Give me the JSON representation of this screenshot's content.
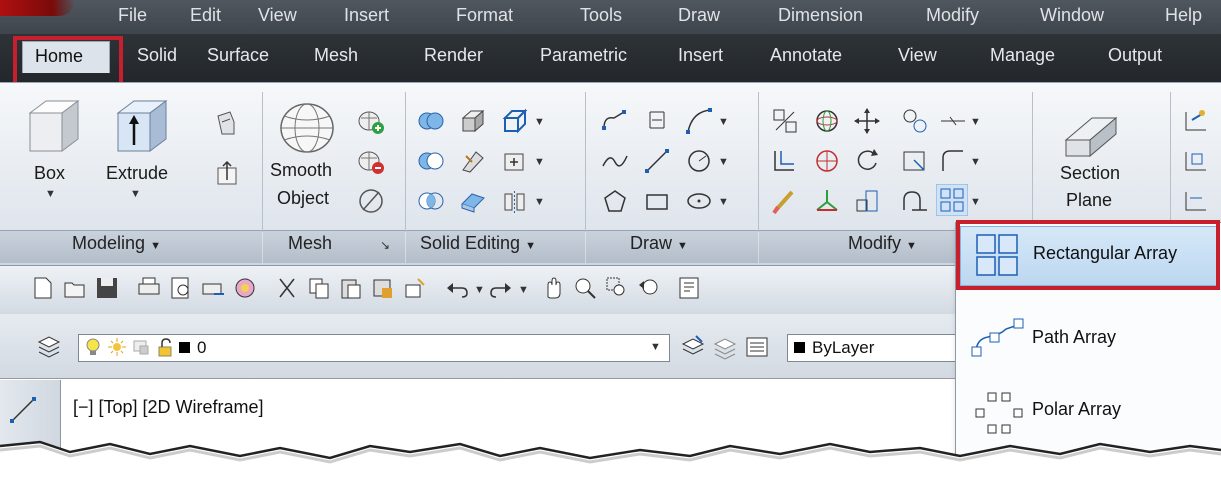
{
  "menubar": {
    "items": [
      "File",
      "Edit",
      "View",
      "Insert",
      "Format",
      "Tools",
      "Draw",
      "Dimension",
      "Modify",
      "Window",
      "Help"
    ]
  },
  "ribbon_tabs": {
    "active": "Home",
    "items": [
      "Solid",
      "Surface",
      "Mesh",
      "Render",
      "Parametric",
      "Insert",
      "Annotate",
      "View",
      "Manage",
      "Output"
    ]
  },
  "modeling": {
    "box_label": "Box",
    "extrude_label": "Extrude",
    "panel_label": "Modeling"
  },
  "mesh": {
    "smooth_label_1": "Smooth",
    "smooth_label_2": "Object",
    "panel_label": "Mesh"
  },
  "solid_editing": {
    "panel_label": "Solid Editing"
  },
  "draw": {
    "panel_label": "Draw"
  },
  "modify": {
    "panel_label": "Modify"
  },
  "section": {
    "label_1": "Section",
    "label_2": "Plane"
  },
  "layer_toolbar": {
    "current_layer": "0",
    "color_combo": "ByLayer"
  },
  "viewport": {
    "label": "[−] [Top] [2D Wireframe]"
  },
  "array_menu": {
    "rectangular": "Rectangular Array",
    "path": "Path Array",
    "polar": "Polar Array"
  },
  "colors": {
    "highlight_red": "#c7202c",
    "menubar": "#474d54",
    "tabbar": "#2a2e33",
    "ribbon": "#e7ecf1",
    "menu_hover": "#c7def3"
  }
}
